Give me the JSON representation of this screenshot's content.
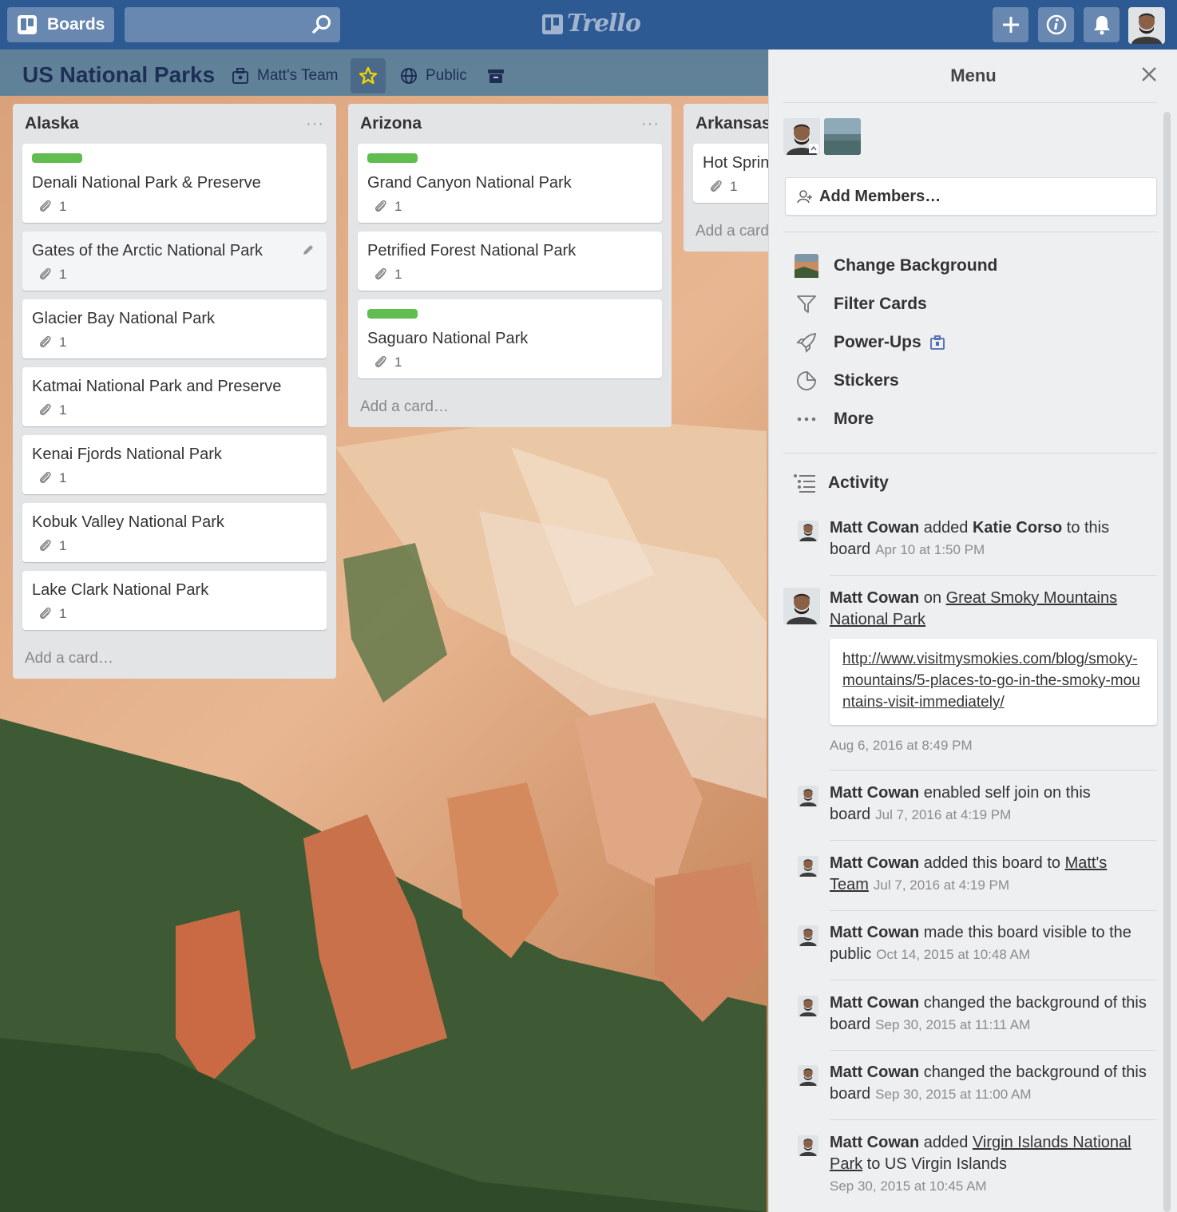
{
  "header": {
    "boards_label": "Boards",
    "search_placeholder": "",
    "logo_text": "Trello"
  },
  "board": {
    "title": "US National Parks",
    "team": "Matt's Team",
    "visibility": "Public"
  },
  "lists": [
    {
      "title": "Alaska",
      "menu": "···",
      "add_card": "Add a card…",
      "cards": [
        {
          "title": "Denali National Park & Preserve",
          "attachments": "1",
          "label": true
        },
        {
          "title": "Gates of the Arctic National Park",
          "attachments": "1",
          "label": false
        },
        {
          "title": "Glacier Bay National Park",
          "attachments": "1",
          "label": false
        },
        {
          "title": "Katmai National Park and Preserve",
          "attachments": "1",
          "label": false
        },
        {
          "title": "Kenai Fjords National Park",
          "attachments": "1",
          "label": false
        },
        {
          "title": "Kobuk Valley National Park",
          "attachments": "1",
          "label": false
        },
        {
          "title": "Lake Clark National Park",
          "attachments": "1",
          "label": false
        }
      ]
    },
    {
      "title": "Arizona",
      "menu": "···",
      "add_card": "Add a card…",
      "cards": [
        {
          "title": "Grand Canyon National Park",
          "attachments": "1",
          "label": true
        },
        {
          "title": "Petrified Forest National Park",
          "attachments": "1",
          "label": false
        },
        {
          "title": "Saguaro National Park",
          "attachments": "1",
          "label": true
        }
      ]
    },
    {
      "title": "Arkansas",
      "add_card": "Add a card…",
      "cards": [
        {
          "title": "Hot Springs National Park",
          "attachments": "1",
          "label": false
        }
      ]
    }
  ],
  "menu": {
    "title": "Menu",
    "add_members": "Add Members…",
    "items": [
      {
        "label": "Change Background",
        "icon": "background-thumbnail"
      },
      {
        "label": "Filter Cards",
        "icon": "filter-icon"
      },
      {
        "label": "Power-Ups",
        "icon": "rocket-icon"
      },
      {
        "label": "Stickers",
        "icon": "sticker-icon"
      },
      {
        "label": "More",
        "icon": "more-icon"
      }
    ],
    "activity_title": "Activity",
    "activity": [
      {
        "who": "Matt Cowan",
        "pre": " added ",
        "bold": "Katie Corso",
        "post": " to this board",
        "date": "Apr 10 at 1:50 PM"
      },
      {
        "who": "Matt Cowan",
        "pre": " on ",
        "link": "Great Smoky Mountains National Park",
        "comment": "http://www.visitmysmokies.com/blog/smoky-mountains/5-places-to-go-in-the-smoky-mountains-visit-immediately/",
        "date": "Aug 6, 2016 at 8:49 PM"
      },
      {
        "who": "Matt Cowan",
        "pre": " enabled self join on this board",
        "date": "Jul 7, 2016 at 4:19 PM"
      },
      {
        "who": "Matt Cowan",
        "pre": " added this board to ",
        "link": "Matt's Team",
        "date": "Jul 7, 2016 at 4:19 PM"
      },
      {
        "who": "Matt Cowan",
        "pre": " made this board visible to the public",
        "date": "Oct 14, 2015 at 10:48 AM"
      },
      {
        "who": "Matt Cowan",
        "pre": " changed the background of this board",
        "date": "Sep 30, 2015 at 11:11 AM"
      },
      {
        "who": "Matt Cowan",
        "pre": " changed the background of this board",
        "date": "Sep 30, 2015 at 11:00 AM"
      },
      {
        "who": "Matt Cowan",
        "pre": " added ",
        "link": "Virgin Islands National Park",
        "post": " to US Virgin Islands",
        "date": "Sep 30, 2015 at 10:45 AM"
      }
    ]
  },
  "colors": {
    "header_bg": "#2e5a93",
    "label_green": "#61bd4f",
    "list_bg": "#e2e4e6",
    "menu_bg": "#edeff0"
  }
}
